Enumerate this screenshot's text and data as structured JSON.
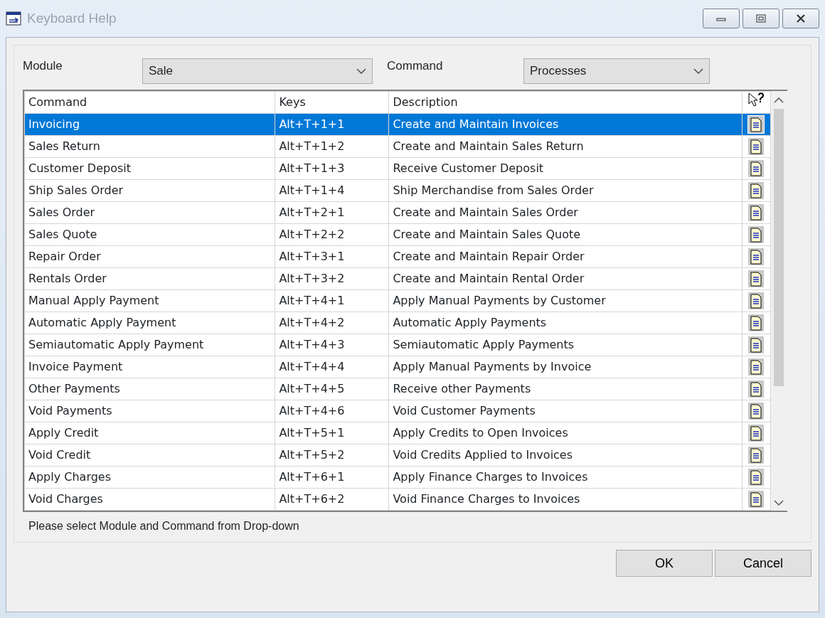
{
  "window": {
    "title": "Keyboard Help"
  },
  "filters": [
    {
      "label": "Module",
      "value": "Sale"
    },
    {
      "label": "Command",
      "value": "Processes"
    }
  ],
  "table": {
    "columns": [
      "Command",
      "Keys",
      "Description"
    ],
    "rows": [
      {
        "command": "Invoicing",
        "keys": "Alt+T+1+1",
        "description": "Create and Maintain Invoices",
        "selected": true
      },
      {
        "command": "Sales Return",
        "keys": "Alt+T+1+2",
        "description": "Create and Maintain Sales Return",
        "selected": false
      },
      {
        "command": "Customer Deposit",
        "keys": "Alt+T+1+3",
        "description": "Receive Customer Deposit",
        "selected": false
      },
      {
        "command": "Ship Sales Order",
        "keys": "Alt+T+1+4",
        "description": "Ship Merchandise from Sales Order",
        "selected": false
      },
      {
        "command": "Sales Order",
        "keys": "Alt+T+2+1",
        "description": "Create and Maintain Sales Order",
        "selected": false
      },
      {
        "command": "Sales Quote",
        "keys": "Alt+T+2+2",
        "description": "Create and Maintain Sales Quote",
        "selected": false
      },
      {
        "command": "Repair Order",
        "keys": "Alt+T+3+1",
        "description": "Create and Maintain Repair Order",
        "selected": false
      },
      {
        "command": "Rentals Order",
        "keys": "Alt+T+3+2",
        "description": "Create and Maintain Rental Order",
        "selected": false
      },
      {
        "command": "Manual Apply Payment",
        "keys": "Alt+T+4+1",
        "description": "Apply Manual Payments by Customer",
        "selected": false
      },
      {
        "command": "Automatic Apply Payment",
        "keys": "Alt+T+4+2",
        "description": "Automatic Apply Payments",
        "selected": false
      },
      {
        "command": "Semiautomatic Apply Payment",
        "keys": "Alt+T+4+3",
        "description": "Semiautomatic Apply Payments",
        "selected": false
      },
      {
        "command": "Invoice Payment",
        "keys": "Alt+T+4+4",
        "description": "Apply Manual Payments by Invoice",
        "selected": false
      },
      {
        "command": "Other Payments",
        "keys": "Alt+T+4+5",
        "description": "Receive other Payments",
        "selected": false
      },
      {
        "command": "Void Payments",
        "keys": "Alt+T+4+6",
        "description": "Void Customer Payments",
        "selected": false
      },
      {
        "command": "Apply Credit",
        "keys": "Alt+T+5+1",
        "description": "Apply Credits to Open Invoices",
        "selected": false
      },
      {
        "command": "Void Credit",
        "keys": "Alt+T+5+2",
        "description": "Void Credits Applied to Invoices",
        "selected": false
      },
      {
        "command": "Apply Charges",
        "keys": "Alt+T+6+1",
        "description": "Apply Finance Charges to Invoices",
        "selected": false
      },
      {
        "command": "Void Charges",
        "keys": "Alt+T+6+2",
        "description": "Void Finance Charges to Invoices",
        "selected": false
      }
    ]
  },
  "status_text": "Please select Module and Command from Drop-down",
  "buttons": [
    "OK",
    "Cancel"
  ]
}
